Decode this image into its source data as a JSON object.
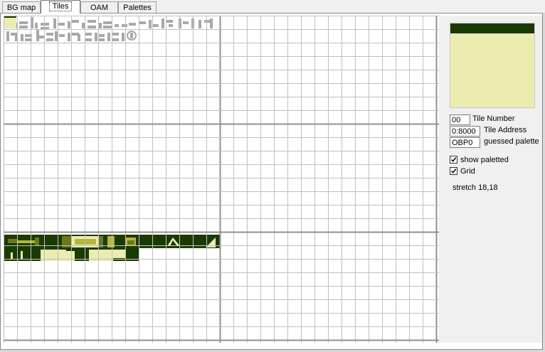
{
  "tabs": [
    {
      "label": "BG map",
      "active": false
    },
    {
      "label": "Tiles",
      "active": true
    },
    {
      "label": "OAM",
      "active": false
    },
    {
      "label": "Palettes",
      "active": false
    }
  ],
  "palette_preview": {
    "colors": [
      "#1a3a04",
      "#ececb0"
    ]
  },
  "info": {
    "tile_number_value": "00",
    "tile_number_label": "Tile Number",
    "tile_address_value": "0:8000",
    "tile_address_label": "Tile Address",
    "palette_value": "OBP0",
    "palette_label": "guessed palette"
  },
  "options": {
    "show_paletted_label": "show paletted",
    "show_paletted_checked": true,
    "grid_label": "Grid",
    "grid_checked": true
  },
  "stretch_text": "stretch 18,18",
  "tile_grid": {
    "columns": 32,
    "rows": 24,
    "selected_tile": "00",
    "grid_color": "#c0c0c0",
    "major_line_color": "#909090",
    "palette": [
      "#ececb0",
      "#b6b63a",
      "#6c7a14",
      "#1a3a04"
    ]
  }
}
